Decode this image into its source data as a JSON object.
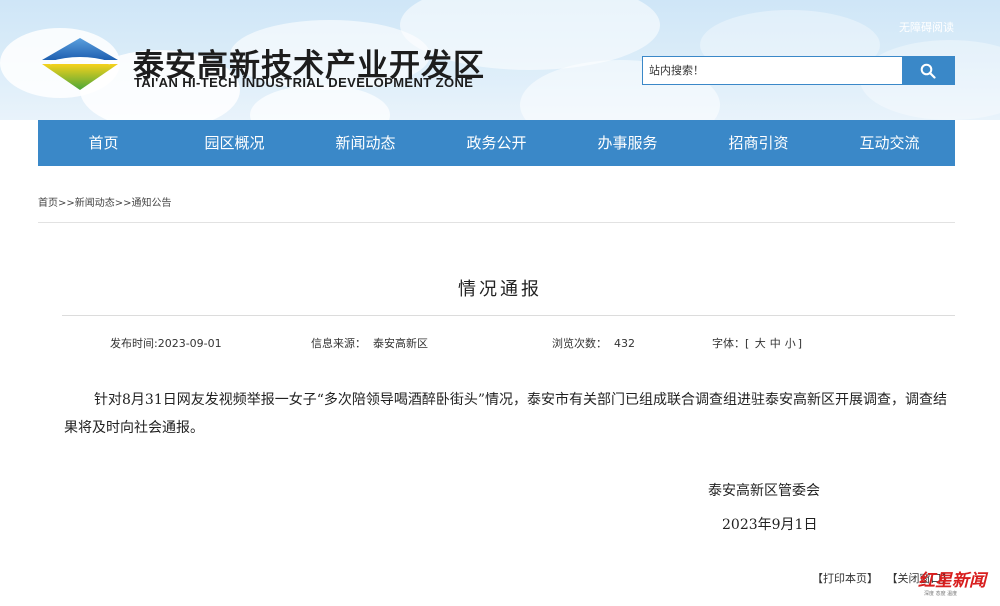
{
  "header": {
    "title_cn": "泰安高新技术产业开发区",
    "title_en": "TAI'AN HI-TECH INDUSTRIAL DEVELOPMENT ZONE",
    "accessibility_link": "无障碍阅读",
    "search": {
      "placeholder": "站内搜索！",
      "icon": "search-icon"
    }
  },
  "nav": {
    "items": [
      {
        "label": "首页"
      },
      {
        "label": "园区概况"
      },
      {
        "label": "新闻动态"
      },
      {
        "label": "政务公开"
      },
      {
        "label": "办事服务"
      },
      {
        "label": "招商引资"
      },
      {
        "label": "互动交流"
      }
    ]
  },
  "breadcrumb": "首页>>新闻动态>>通知公告",
  "article": {
    "title": "情况通报",
    "meta": {
      "publish_label": "发布时间:",
      "publish_date": "2023-09-01",
      "source_label": "信息来源：",
      "source": "泰安高新区",
      "views_label": "浏览次数：",
      "views": "432",
      "font_label": "字体：",
      "font_open": "[",
      "font_large": "大",
      "font_medium": "中",
      "font_small": "小",
      "font_close": "]"
    },
    "body": "针对8月31日网友发视频举报一女子“多次陪领导喝酒醉卧街头”情况，泰安市有关部门已组成联合调查组进驻泰安高新区开展调查，调查结果将及时向社会通报。",
    "signer": "泰安高新区管委会",
    "date": "2023年9月1日"
  },
  "actions": {
    "print": "【打印本页】",
    "close": "【关闭窗口】"
  },
  "watermark": {
    "text": "红星新闻",
    "sub": "深度 态度 温度"
  },
  "colors": {
    "primary": "#3a88c8",
    "watermark": "#d81e1e"
  }
}
